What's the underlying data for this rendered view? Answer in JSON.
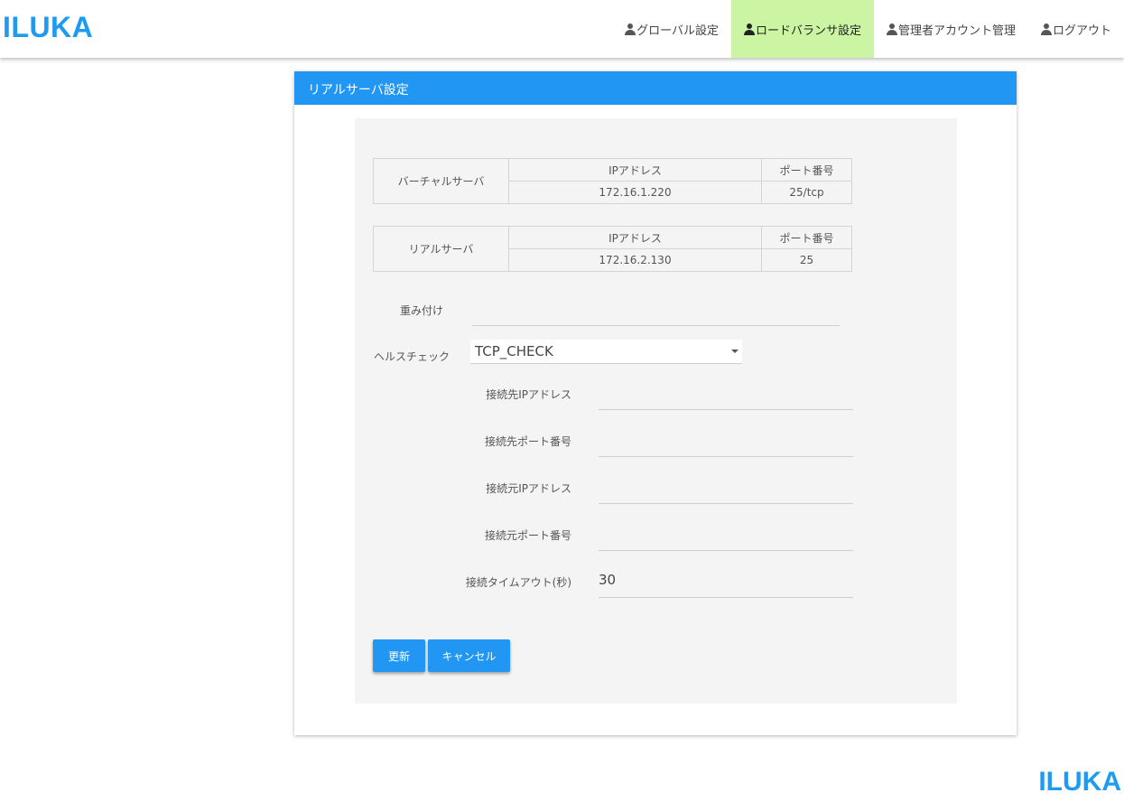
{
  "header": {
    "logo": "ILUKA",
    "nav": [
      {
        "label": "グローバル設定",
        "icon": "person-icon",
        "active": false
      },
      {
        "label": "ロードバランサ設定",
        "icon": "person-icon",
        "active": true
      },
      {
        "label": "管理者アカウント管理",
        "icon": "person-icon",
        "active": false
      },
      {
        "label": "ログアウト",
        "icon": "person-icon",
        "active": false
      }
    ],
    "active_color": "#ccf5a3"
  },
  "card": {
    "title": "リアルサーバ設定",
    "header_color": "#2196f3"
  },
  "virtual_server": {
    "label": "バーチャルサーバ",
    "ip_header": "IPアドレス",
    "port_header": "ポート番号",
    "ip": "172.16.1.220",
    "port": "25/tcp"
  },
  "real_server": {
    "label": "リアルサーバ",
    "ip_header": "IPアドレス",
    "port_header": "ポート番号",
    "ip": "172.16.2.130",
    "port": "25"
  },
  "form": {
    "weight_label": "重み付け",
    "weight_value": "",
    "healthcheck_label": "ヘルスチェック",
    "healthcheck_value": "TCP_CHECK",
    "dest_ip_label": "接続先IPアドレス",
    "dest_ip_value": "",
    "dest_port_label": "接続先ポート番号",
    "dest_port_value": "",
    "src_ip_label": "接続元IPアドレス",
    "src_ip_value": "",
    "src_port_label": "接続元ポート番号",
    "src_port_value": "",
    "timeout_label": "接続タイムアウト(秒)",
    "timeout_value": "30"
  },
  "buttons": {
    "update": "更新",
    "cancel": "キャンセル"
  },
  "footer": {
    "logo": "ILUKA"
  }
}
